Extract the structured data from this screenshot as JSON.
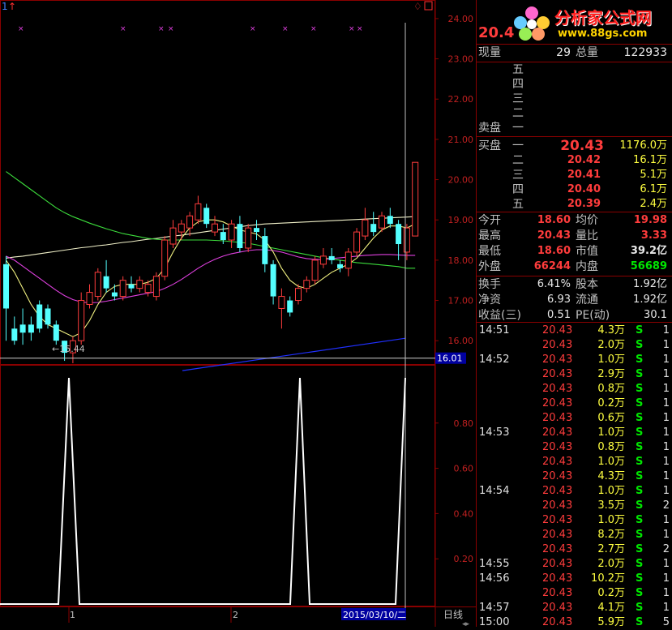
{
  "chart_data": [
    {
      "type": "candlestick",
      "ylim": [
        15.4,
        24.3
      ],
      "yticks": [
        "24.00",
        "23.00",
        "22.00",
        "21.00",
        "20.00",
        "19.00",
        "18.00",
        "17.00",
        "16.00"
      ],
      "price_marker": "16.01",
      "low_label": "←15.44",
      "cross_marks": 11,
      "candles": [
        {
          "o": 16.8,
          "h": 18.1,
          "l": 16.0,
          "c": 17.9,
          "up": false
        },
        {
          "o": 16.0,
          "h": 16.6,
          "l": 15.9,
          "c": 16.3,
          "up": false
        },
        {
          "o": 16.4,
          "h": 16.8,
          "l": 15.9,
          "c": 16.2,
          "up": false
        },
        {
          "o": 16.2,
          "h": 16.6,
          "l": 16.0,
          "c": 16.4,
          "up": false
        },
        {
          "o": 16.3,
          "h": 17.0,
          "l": 16.2,
          "c": 16.9,
          "up": false
        },
        {
          "o": 16.8,
          "h": 16.9,
          "l": 16.3,
          "c": 16.4,
          "up": false
        },
        {
          "o": 16.4,
          "h": 16.5,
          "l": 15.9,
          "c": 16.0,
          "up": false
        },
        {
          "o": 15.7,
          "h": 16.0,
          "l": 15.5,
          "c": 16.0,
          "up": false
        },
        {
          "o": 15.7,
          "h": 16.1,
          "l": 15.44,
          "c": 16.0,
          "up": true
        },
        {
          "o": 16.0,
          "h": 17.2,
          "l": 15.9,
          "c": 17.0,
          "up": true
        },
        {
          "o": 16.9,
          "h": 17.4,
          "l": 16.8,
          "c": 17.2,
          "up": true
        },
        {
          "o": 17.1,
          "h": 17.8,
          "l": 17.0,
          "c": 17.7,
          "up": true
        },
        {
          "o": 17.6,
          "h": 18.0,
          "l": 17.2,
          "c": 17.3,
          "up": false
        },
        {
          "o": 17.2,
          "h": 17.4,
          "l": 17.0,
          "c": 17.1,
          "up": false
        },
        {
          "o": 17.1,
          "h": 17.6,
          "l": 17.0,
          "c": 17.5,
          "up": true
        },
        {
          "o": 17.4,
          "h": 17.6,
          "l": 17.2,
          "c": 17.3,
          "up": false
        },
        {
          "o": 17.3,
          "h": 17.6,
          "l": 17.2,
          "c": 17.5,
          "up": true
        },
        {
          "o": 17.4,
          "h": 17.5,
          "l": 17.1,
          "c": 17.2,
          "up": true
        },
        {
          "o": 17.1,
          "h": 17.7,
          "l": 17.0,
          "c": 17.6,
          "up": true
        },
        {
          "o": 17.6,
          "h": 18.6,
          "l": 17.5,
          "c": 18.5,
          "up": true
        },
        {
          "o": 18.4,
          "h": 19.0,
          "l": 18.3,
          "c": 18.8,
          "up": true
        },
        {
          "o": 18.7,
          "h": 19.0,
          "l": 18.5,
          "c": 18.9,
          "up": true
        },
        {
          "o": 18.8,
          "h": 19.2,
          "l": 18.6,
          "c": 19.1,
          "up": true
        },
        {
          "o": 19.0,
          "h": 19.6,
          "l": 18.9,
          "c": 19.4,
          "up": true
        },
        {
          "o": 19.3,
          "h": 19.4,
          "l": 18.8,
          "c": 18.9,
          "up": false
        },
        {
          "o": 18.9,
          "h": 19.1,
          "l": 18.6,
          "c": 18.7,
          "up": true
        },
        {
          "o": 18.7,
          "h": 18.9,
          "l": 18.4,
          "c": 18.5,
          "up": false
        },
        {
          "o": 18.5,
          "h": 19.0,
          "l": 18.3,
          "c": 18.9,
          "up": true
        },
        {
          "o": 18.9,
          "h": 19.1,
          "l": 18.2,
          "c": 18.3,
          "up": false
        },
        {
          "o": 18.3,
          "h": 18.9,
          "l": 18.2,
          "c": 18.8,
          "up": true
        },
        {
          "o": 18.8,
          "h": 19.0,
          "l": 18.5,
          "c": 18.7,
          "up": false
        },
        {
          "o": 18.6,
          "h": 18.8,
          "l": 17.7,
          "c": 17.9,
          "up": false
        },
        {
          "o": 17.9,
          "h": 18.0,
          "l": 16.9,
          "c": 17.1,
          "up": false
        },
        {
          "o": 17.1,
          "h": 17.3,
          "l": 16.3,
          "c": 16.8,
          "up": true
        },
        {
          "o": 16.7,
          "h": 17.1,
          "l": 16.6,
          "c": 17.0,
          "up": false
        },
        {
          "o": 17.0,
          "h": 17.4,
          "l": 16.9,
          "c": 17.3,
          "up": true
        },
        {
          "o": 17.3,
          "h": 17.6,
          "l": 17.2,
          "c": 17.5,
          "up": true
        },
        {
          "o": 17.5,
          "h": 18.1,
          "l": 17.4,
          "c": 18.0,
          "up": true
        },
        {
          "o": 17.9,
          "h": 18.3,
          "l": 17.8,
          "c": 18.1,
          "up": true
        },
        {
          "o": 18.1,
          "h": 18.3,
          "l": 17.9,
          "c": 18.0,
          "up": false
        },
        {
          "o": 17.9,
          "h": 18.0,
          "l": 17.7,
          "c": 17.8,
          "up": false
        },
        {
          "o": 17.8,
          "h": 18.3,
          "l": 17.6,
          "c": 18.2,
          "up": true
        },
        {
          "o": 18.2,
          "h": 18.8,
          "l": 18.1,
          "c": 18.7,
          "up": true
        },
        {
          "o": 18.6,
          "h": 19.3,
          "l": 18.5,
          "c": 19.0,
          "up": true
        },
        {
          "o": 18.9,
          "h": 19.2,
          "l": 18.6,
          "c": 18.7,
          "up": false
        },
        {
          "o": 18.8,
          "h": 19.2,
          "l": 18.7,
          "c": 19.1,
          "up": true
        },
        {
          "o": 19.1,
          "h": 19.3,
          "l": 18.8,
          "c": 18.9,
          "up": false
        },
        {
          "o": 18.9,
          "h": 19.0,
          "l": 18.0,
          "c": 18.4,
          "up": false
        },
        {
          "o": 18.2,
          "h": 18.9,
          "l": 18.0,
          "c": 18.8,
          "up": true
        },
        {
          "o": 18.6,
          "h": 20.43,
          "l": 18.6,
          "c": 20.43,
          "up": true
        }
      ],
      "ma_lines": [
        {
          "color": "#f0f0c8",
          "values": [
            18.05,
            18.08,
            18.1,
            18.13,
            18.16,
            18.19,
            18.22,
            18.25,
            18.28,
            18.31,
            18.33,
            18.36,
            18.38,
            18.41,
            18.44,
            18.46,
            18.49,
            18.52,
            18.54,
            18.57,
            18.6,
            18.62,
            18.65,
            18.68,
            18.71,
            18.74,
            18.77,
            18.8,
            18.83,
            18.86,
            18.88,
            18.9,
            18.91,
            18.92,
            18.93,
            18.94,
            18.95,
            18.96,
            18.97,
            18.98,
            18.99,
            19.0,
            19.01,
            19.02,
            19.03,
            19.04,
            19.05,
            19.06,
            19.07,
            19.08
          ]
        },
        {
          "color": "#3cdc3c",
          "values": [
            20.2,
            20.05,
            19.9,
            19.75,
            19.6,
            19.45,
            19.3,
            19.18,
            19.08,
            19.0,
            18.92,
            18.85,
            18.78,
            18.72,
            18.66,
            18.62,
            18.58,
            18.54,
            18.52,
            18.5,
            18.5,
            18.5,
            18.5,
            18.5,
            18.5,
            18.49,
            18.48,
            18.46,
            18.44,
            18.42,
            18.38,
            18.34,
            18.3,
            18.26,
            18.22,
            18.18,
            18.14,
            18.1,
            18.06,
            18.03,
            18.0,
            17.97,
            17.94,
            17.92,
            17.9,
            17.88,
            17.86,
            17.84,
            17.8,
            17.8
          ]
        },
        {
          "color": "#e040e0",
          "values": [
            18.1,
            18.0,
            17.85,
            17.7,
            17.55,
            17.4,
            17.25,
            17.12,
            17.02,
            16.96,
            16.94,
            16.95,
            16.98,
            17.02,
            17.06,
            17.1,
            17.14,
            17.18,
            17.22,
            17.3,
            17.4,
            17.52,
            17.66,
            17.8,
            17.92,
            18.02,
            18.1,
            18.16,
            18.2,
            18.24,
            18.26,
            18.26,
            18.24,
            18.2,
            18.14,
            18.08,
            18.04,
            18.02,
            18.02,
            18.04,
            18.06,
            18.08,
            18.1,
            18.12,
            18.13,
            18.14,
            18.14,
            18.13,
            18.12,
            18.12
          ]
        },
        {
          "color": "#f0f080",
          "values": [
            18.0,
            17.7,
            17.3,
            16.9,
            16.6,
            16.4,
            16.3,
            16.2,
            16.1,
            16.2,
            16.5,
            16.9,
            17.2,
            17.35,
            17.4,
            17.4,
            17.4,
            17.45,
            17.55,
            17.8,
            18.2,
            18.55,
            18.8,
            18.95,
            19.0,
            19.0,
            18.95,
            18.85,
            18.75,
            18.7,
            18.65,
            18.5,
            18.2,
            17.8,
            17.5,
            17.35,
            17.3,
            17.4,
            17.55,
            17.7,
            17.8,
            17.9,
            18.05,
            18.3,
            18.55,
            18.75,
            18.85,
            18.85,
            18.8,
            18.9
          ]
        }
      ],
      "blue_line": {
        "x": [
          225,
          500
        ],
        "y": [
          15.7,
          16.0
        ]
      }
    },
    {
      "type": "line",
      "ylim": [
        0,
        1.05
      ],
      "yticks": [
        "0.80",
        "0.60",
        "0.40",
        "0.20"
      ],
      "x": [
        0,
        72,
        85,
        98,
        358,
        370,
        382,
        488,
        500
      ],
      "values": [
        0,
        0,
        1,
        0,
        0,
        1,
        0,
        0,
        1
      ],
      "x_labels": [
        "1",
        "2"
      ],
      "date_label": "2015/03/10/二"
    }
  ],
  "bottom_right_label": "日线",
  "top_icon": "♢",
  "top_left_marker": "↑",
  "quote": {
    "price": "20.4",
    "now_vol_label": "现量",
    "now_vol": "29",
    "total_vol_label": "总量",
    "total_vol": "122933",
    "sell_title": "卖盘",
    "sell_levels": [
      "五",
      "四",
      "三",
      "二",
      "一"
    ],
    "buy_title": "买盘",
    "buy_levels": [
      {
        "level": "一",
        "price": "20.43",
        "vol": "1176.0万"
      },
      {
        "level": "二",
        "price": "20.42",
        "vol": "16.1万"
      },
      {
        "level": "三",
        "price": "20.41",
        "vol": "5.1万"
      },
      {
        "level": "四",
        "price": "20.40",
        "vol": "6.1万"
      },
      {
        "level": "五",
        "price": "20.39",
        "vol": "2.4万"
      }
    ],
    "stats": [
      {
        "l1": "今开",
        "v1": "18.60",
        "l2": "均价",
        "v2": "19.98",
        "c1": "red",
        "c2": "red"
      },
      {
        "l1": "最高",
        "v1": "20.43",
        "l2": "量比",
        "v2": "3.33",
        "c1": "red",
        "c2": "red"
      },
      {
        "l1": "最低",
        "v1": "18.60",
        "l2": "市值",
        "v2": "39.2亿",
        "c1": "red",
        "c2": "white"
      },
      {
        "l1": "外盘",
        "v1": "66244",
        "l2": "内盘",
        "v2": "56689",
        "c1": "red",
        "c2": "green"
      }
    ],
    "stats2": [
      {
        "l1": "换手",
        "v1": "6.41%",
        "l2": "股本",
        "v2": "1.92亿"
      },
      {
        "l1": "净资",
        "v1": "6.93",
        "l2": "流通",
        "v2": "1.92亿"
      },
      {
        "l1": "收益(三)",
        "v1": "0.51",
        "l2": "PE(动)",
        "v2": "30.1"
      }
    ]
  },
  "ticks": [
    {
      "time": "14:51",
      "price": "20.43",
      "vol": "4.3万",
      "side": "S",
      "cnt": "1"
    },
    {
      "time": "",
      "price": "20.43",
      "vol": "2.0万",
      "side": "S",
      "cnt": "1"
    },
    {
      "time": "14:52",
      "price": "20.43",
      "vol": "1.0万",
      "side": "S",
      "cnt": "1"
    },
    {
      "time": "",
      "price": "20.43",
      "vol": "2.9万",
      "side": "S",
      "cnt": "1"
    },
    {
      "time": "",
      "price": "20.43",
      "vol": "0.8万",
      "side": "S",
      "cnt": "1"
    },
    {
      "time": "",
      "price": "20.43",
      "vol": "0.2万",
      "side": "S",
      "cnt": "1"
    },
    {
      "time": "",
      "price": "20.43",
      "vol": "0.6万",
      "side": "S",
      "cnt": "1"
    },
    {
      "time": "14:53",
      "price": "20.43",
      "vol": "1.0万",
      "side": "S",
      "cnt": "1"
    },
    {
      "time": "",
      "price": "20.43",
      "vol": "0.8万",
      "side": "S",
      "cnt": "1"
    },
    {
      "time": "",
      "price": "20.43",
      "vol": "1.0万",
      "side": "S",
      "cnt": "1"
    },
    {
      "time": "",
      "price": "20.43",
      "vol": "4.3万",
      "side": "S",
      "cnt": "1"
    },
    {
      "time": "14:54",
      "price": "20.43",
      "vol": "1.0万",
      "side": "S",
      "cnt": "1"
    },
    {
      "time": "",
      "price": "20.43",
      "vol": "3.5万",
      "side": "S",
      "cnt": "2"
    },
    {
      "time": "",
      "price": "20.43",
      "vol": "1.0万",
      "side": "S",
      "cnt": "1"
    },
    {
      "time": "",
      "price": "20.43",
      "vol": "8.2万",
      "side": "S",
      "cnt": "1"
    },
    {
      "time": "",
      "price": "20.43",
      "vol": "2.7万",
      "side": "S",
      "cnt": "2"
    },
    {
      "time": "14:55",
      "price": "20.43",
      "vol": "2.0万",
      "side": "S",
      "cnt": "1"
    },
    {
      "time": "14:56",
      "price": "20.43",
      "vol": "10.2万",
      "side": "S",
      "cnt": "1"
    },
    {
      "time": "",
      "price": "20.43",
      "vol": "0.2万",
      "side": "S",
      "cnt": "1"
    },
    {
      "time": "14:57",
      "price": "20.43",
      "vol": "4.1万",
      "side": "S",
      "cnt": "1"
    },
    {
      "time": "15:00",
      "price": "20.43",
      "vol": "5.9万",
      "side": "S",
      "cnt": "5"
    }
  ],
  "logo": {
    "text": "分析家公式网",
    "url_text": "www.88gs.com"
  }
}
